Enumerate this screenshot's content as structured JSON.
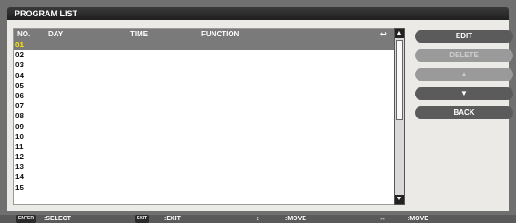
{
  "title": "PROGRAM LIST",
  "table": {
    "headers": {
      "no": "NO.",
      "day": "DAY",
      "time": "TIME",
      "function": "FUNCTION",
      "icon": "return-icon"
    },
    "rows": [
      "01",
      "02",
      "03",
      "04",
      "05",
      "06",
      "07",
      "08",
      "09",
      "10",
      "11",
      "12",
      "13",
      "14",
      "15"
    ],
    "selected_index": 0
  },
  "buttons": {
    "edit": "EDIT",
    "delete": "DELETE",
    "up_icon": "up-triangle-icon",
    "down_icon": "down-triangle-icon",
    "back": "BACK"
  },
  "footer": {
    "enter_key": "ENTER",
    "select": ":SELECT",
    "exit_key": "EXIT",
    "exit": ":EXIT",
    "move1": ":MOVE",
    "move2": ":MOVE"
  },
  "scrollbar": {
    "position_fraction": 0.0
  }
}
